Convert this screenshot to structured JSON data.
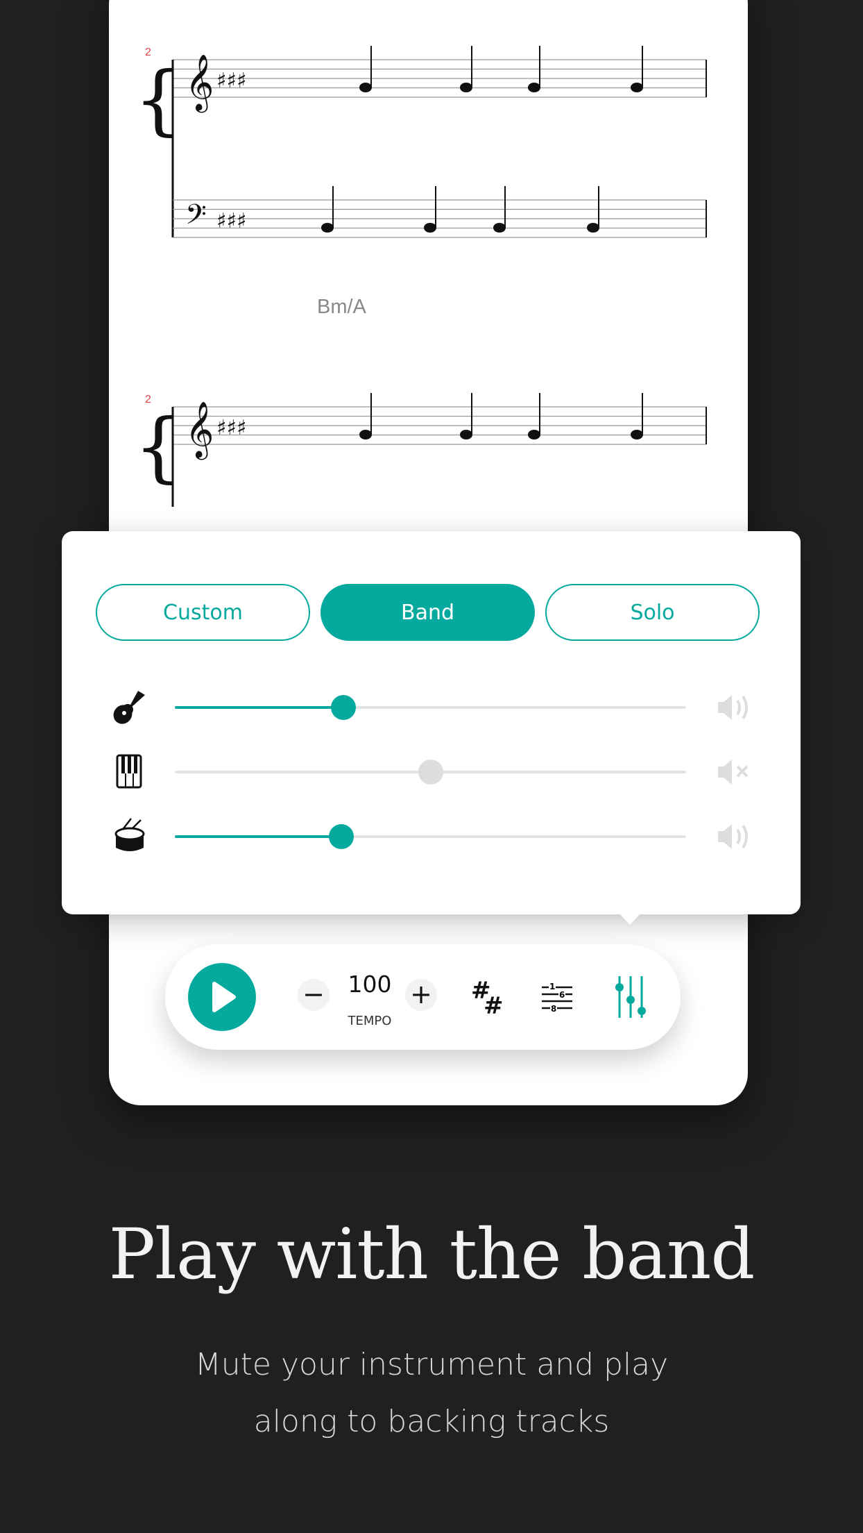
{
  "score": {
    "measure_number": "2",
    "chord_symbol": "Bm/A"
  },
  "mixer": {
    "modes": [
      {
        "label": "Custom",
        "active": false
      },
      {
        "label": "Band",
        "active": true
      },
      {
        "label": "Solo",
        "active": false
      }
    ],
    "tracks": [
      {
        "instrument": "guitar-icon",
        "volume": 0.33,
        "muted": false
      },
      {
        "instrument": "piano-icon",
        "volume": 0.5,
        "muted": true
      },
      {
        "instrument": "drum-icon",
        "volume": 0.33,
        "muted": false
      }
    ]
  },
  "toolbar": {
    "tempo_value": "100",
    "tempo_label": "TEMPO",
    "minus": "−",
    "plus": "+"
  },
  "promo": {
    "title": "Play with the band",
    "subtitle_line1": "Mute your instrument and play",
    "subtitle_line2": "along to backing tracks"
  },
  "colors": {
    "accent": "#06a99d",
    "background": "#202020",
    "measure_number": "#e04040"
  }
}
